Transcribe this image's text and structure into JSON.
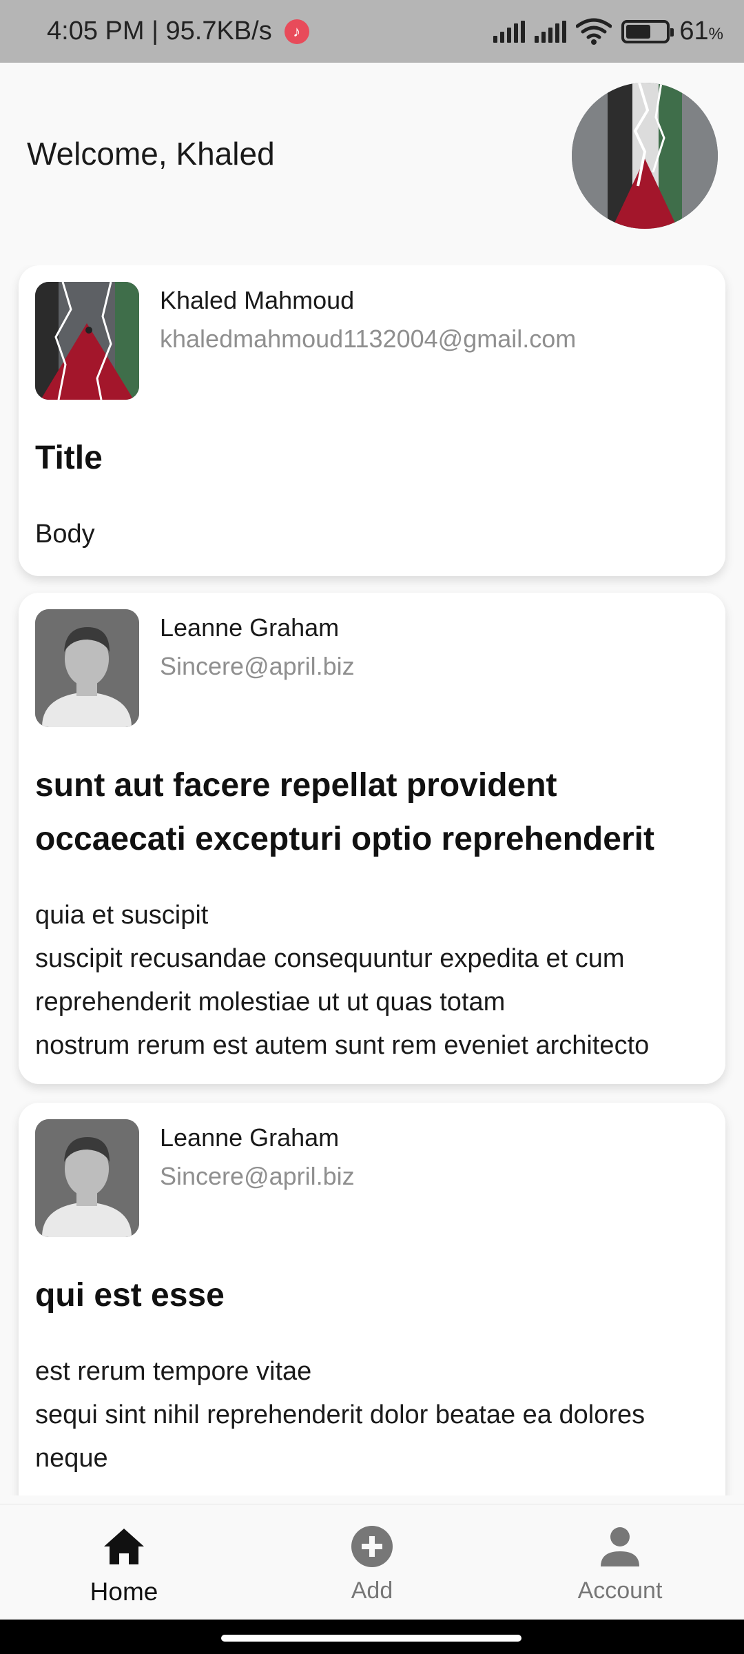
{
  "status_bar": {
    "time_speed": "4:05 PM | 95.7KB/s",
    "app_glyph": "♪",
    "battery_level": "61",
    "battery_unit": "%",
    "battery_fraction": 0.61
  },
  "header": {
    "welcome_text": "Welcome, Khaled",
    "avatar_icon": "profile-photo"
  },
  "posts": [
    {
      "name": "Khaled Mahmoud",
      "email": "khaledmahmoud1132004@gmail.com",
      "title": "Title",
      "body": "Body",
      "avatar_icon": "profile-photo"
    },
    {
      "name": "Leanne Graham",
      "email": "Sincere@april.biz",
      "title": "sunt aut facere repellat provident occaecati excepturi optio reprehenderit",
      "body": "quia et suscipit\nsuscipit recusandae consequuntur expedita et cum reprehenderit molestiae ut ut quas totam\nnostrum rerum est autem sunt rem eveniet architecto",
      "avatar_icon": "default-person-avatar"
    },
    {
      "name": "Leanne Graham",
      "email": "Sincere@april.biz",
      "title": "qui est esse",
      "body": "est rerum tempore vitae\nsequi sint nihil reprehenderit dolor beatae ea dolores neque",
      "avatar_icon": "default-person-avatar"
    }
  ],
  "bottom_nav": {
    "items": [
      {
        "label": "Home",
        "icon": "home-icon",
        "active": true
      },
      {
        "label": "Add",
        "icon": "add-circle-icon",
        "active": false
      },
      {
        "label": "Account",
        "icon": "person-icon",
        "active": false
      }
    ]
  },
  "colors": {
    "status_bar": "#b5b5b5",
    "background": "#f9f9f9",
    "card": "#ffffff",
    "secondary_text": "#8f8f8f",
    "inactive_icon": "#777777",
    "active_icon": "#111111"
  }
}
